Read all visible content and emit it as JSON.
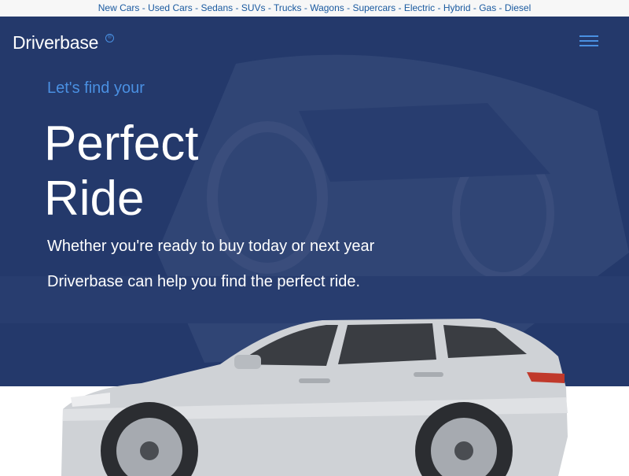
{
  "top_links": [
    "New Cars",
    "Used Cars",
    "Sedans",
    "SUVs",
    "Trucks",
    "Wagons",
    "Supercars",
    "Electric",
    "Hybrid",
    "Gas",
    "Diesel"
  ],
  "brand": {
    "name": "Driverbase",
    "mark": "®"
  },
  "menu": {
    "icon": "hamburger-menu-icon"
  },
  "hero": {
    "kicker": "Let's find your",
    "headline_line1": "Perfect",
    "headline_line2": "Ride",
    "subline1": "Whether you're ready to buy today or next year",
    "subline2": "Driverbase can help you find the perfect ride."
  },
  "colors": {
    "hero": "#24396b",
    "accent": "#4a90e2",
    "link": "#1a5aa0"
  }
}
